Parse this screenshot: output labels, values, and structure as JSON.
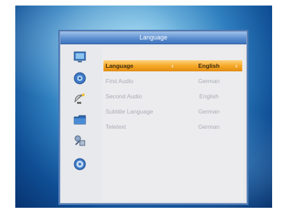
{
  "dialog": {
    "title": "Language"
  },
  "sidebar": {
    "icons": [
      "monitor-icon",
      "disc-icon",
      "satellite-dish-icon",
      "folder-icon",
      "tools-icon",
      "info-disc-icon"
    ]
  },
  "settings": [
    {
      "label": "Language",
      "value": "English",
      "selected": true
    },
    {
      "label": "First Audio",
      "value": "German",
      "selected": false
    },
    {
      "label": "Second Audio",
      "value": "English",
      "selected": false
    },
    {
      "label": "Subtitle Language",
      "value": "German",
      "selected": false
    },
    {
      "label": "Teletext",
      "value": "German",
      "selected": false
    }
  ],
  "arrows": {
    "left": "‹",
    "right": "›"
  },
  "colors": {
    "highlight": "#f5a623",
    "title_bar": "#5c8fd0",
    "panel": "#e7e9ec",
    "text_dim": "#a9acb4"
  }
}
